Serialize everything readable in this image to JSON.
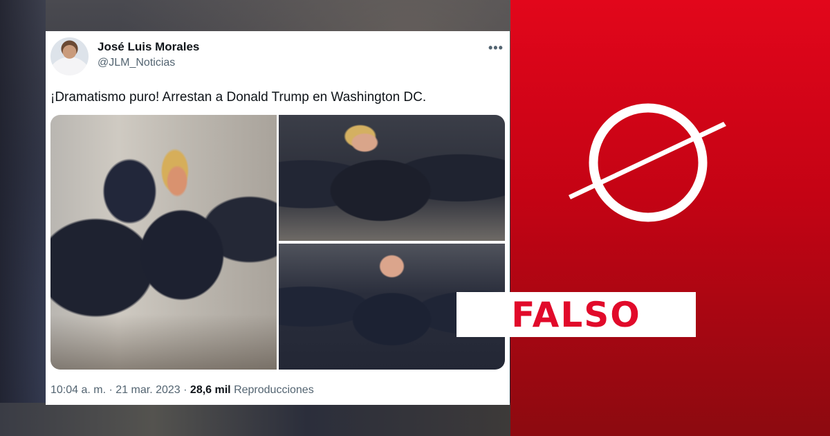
{
  "tweet": {
    "author_name": "José Luis Morales",
    "author_handle": "@JLM_Noticias",
    "more_label": "•••",
    "text": "¡Dramatismo puro! Arrestan a Donald Trump en Washington DC.",
    "time": "10:04 a. m.",
    "separator": "·",
    "date": "21 mar. 2023",
    "views_count": "28,6 mil",
    "views_label": "Reproducciones"
  },
  "verdict": {
    "label": "FALSO",
    "icon": "no-sign-icon"
  },
  "colors": {
    "accent_red": "#e10a2a",
    "panel_red": "#d0051a",
    "text_primary": "#0f1419",
    "text_secondary": "#536471"
  }
}
